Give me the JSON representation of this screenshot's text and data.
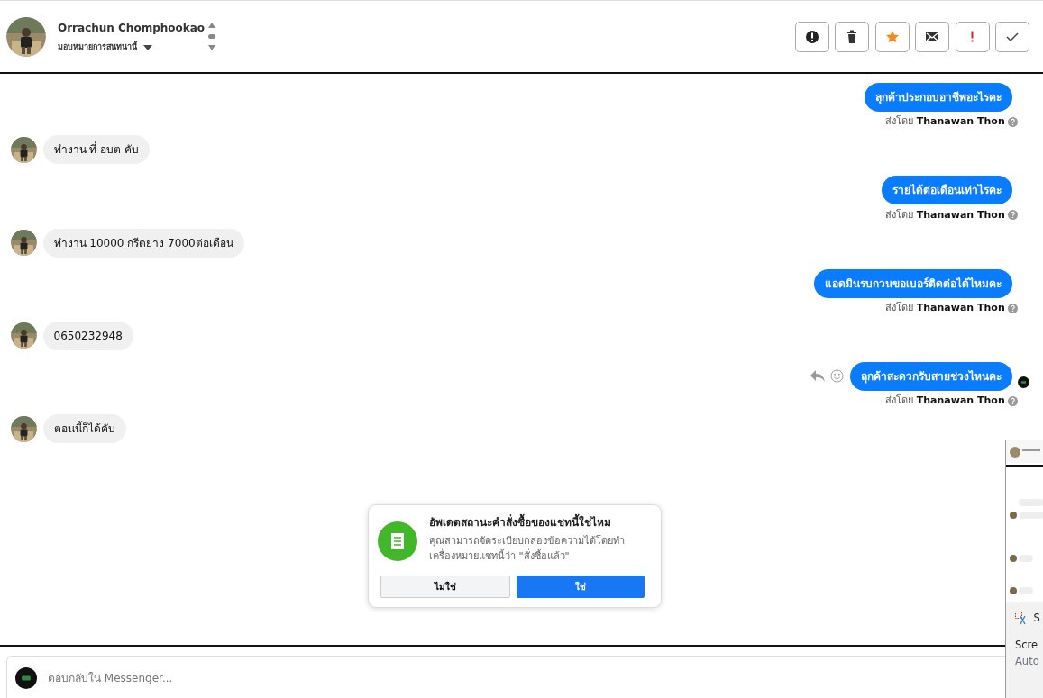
{
  "header": {
    "name": "Orrachun Chomphookao",
    "assign_label": "มอบหมายการสนทนานี้",
    "actions": [
      {
        "kind": "spam"
      },
      {
        "kind": "delete"
      },
      {
        "kind": "star"
      },
      {
        "kind": "unread"
      },
      {
        "kind": "important"
      },
      {
        "kind": "done"
      }
    ]
  },
  "messages": [
    {
      "kind": "sent",
      "text": "ลุกค้าประกอบอาชีพอะไรคะ",
      "sent_by_label": "ส่งโดย",
      "sender": "Thanawan Thon",
      "hovered": false,
      "seen": false
    },
    {
      "kind": "received",
      "text": "ทำงาน ที่ อบต คับ"
    },
    {
      "kind": "sent",
      "text": "รายได้ต่อเดือนเท่าไรคะ",
      "sent_by_label": "ส่งโดย",
      "sender": "Thanawan Thon",
      "hovered": false,
      "seen": false
    },
    {
      "kind": "received",
      "text": "ทำงาน  10000  กรีดยาง 7000ต่อเดือน"
    },
    {
      "kind": "sent",
      "text": "แอดมินรบกวนขอเบอร์ติดต่อได้ไหมคะ",
      "sent_by_label": "ส่งโดย",
      "sender": "Thanawan Thon",
      "hovered": false,
      "seen": false
    },
    {
      "kind": "received",
      "text": "0650232948"
    },
    {
      "kind": "sent",
      "text": "ลุกค้าสะดวกรับสายช่วงไหนคะ",
      "sent_by_label": "ส่งโดย",
      "sender": "Thanawan Thon",
      "hovered": true,
      "seen": true
    },
    {
      "kind": "received",
      "text": "ตอนนี้ก็ได้คับ"
    }
  ],
  "prompt": {
    "title": "อัพเดตสถานะคำสั่งซื้อของแชทนี้ใช่ไหม",
    "body": "คุณสามารถจัดระเบียบกล่องข้อความได้โดยทำเครื่องหมายแชทนี้ว่า \"สั่งซื้อแล้ว\"",
    "no_button": "ไม่ใช่",
    "yes_button": "ใช่"
  },
  "composer": {
    "placeholder": "ตอบกลับใน Messenger..."
  },
  "notification": {
    "app_initial": "S",
    "line_1": "Scre",
    "line_2": "Auto"
  }
}
